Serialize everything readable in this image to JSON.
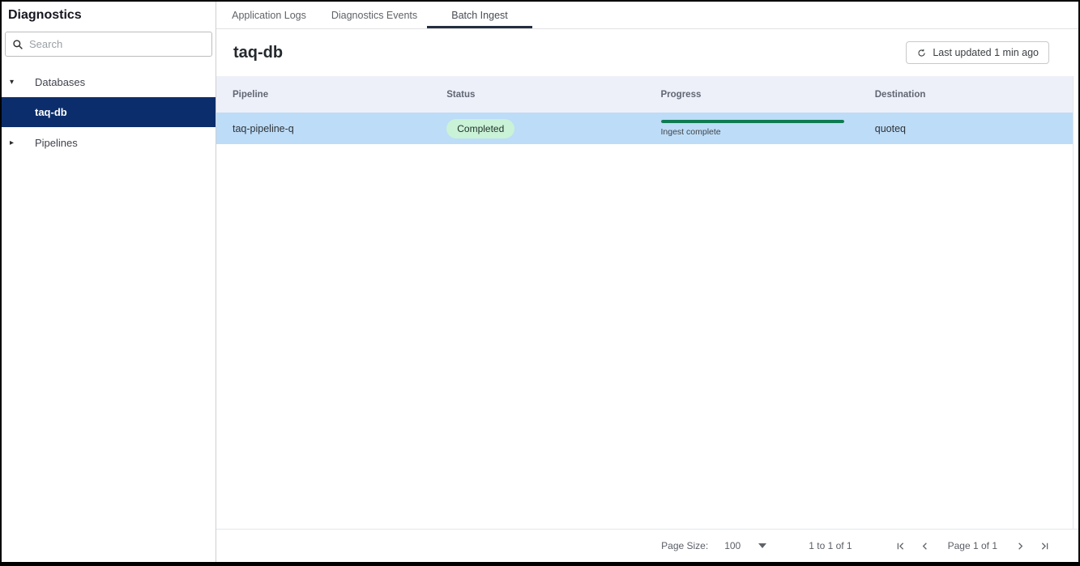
{
  "colors": {
    "accent": "#0c2d6b",
    "row_highlight": "#bddcf7",
    "header_bg": "#eef0f9",
    "badge_bg": "#c9f2d7",
    "progress_green": "#0e7b52",
    "tab_underline": "#232e41"
  },
  "sidebar": {
    "title": "Diagnostics",
    "search": {
      "placeholder": "Search"
    },
    "tree": [
      {
        "label": "Databases",
        "caret": "▾",
        "expanded": true,
        "selected": false,
        "level": 0
      },
      {
        "label": "taq-db",
        "caret": "",
        "expanded": false,
        "selected": true,
        "level": 1
      },
      {
        "label": "Pipelines",
        "caret": "▸",
        "expanded": false,
        "selected": false,
        "level": 0
      }
    ]
  },
  "tabs": [
    {
      "label": "Application Logs",
      "active": false
    },
    {
      "label": "Diagnostics Events",
      "active": false
    },
    {
      "label": "Batch Ingest",
      "active": true
    }
  ],
  "main": {
    "title": "taq-db",
    "last_updated_label": "Last updated 1 min ago"
  },
  "table": {
    "columns": [
      "Pipeline",
      "Status",
      "Progress",
      "Destination"
    ],
    "rows": [
      {
        "pipeline": "taq-pipeline-q",
        "status": "Completed",
        "progress_label": "Ingest complete",
        "progress_percent": 100,
        "destination": "quoteq"
      }
    ]
  },
  "pagination": {
    "page_size_label": "Page Size:",
    "page_size": "100",
    "range_text": "1 to 1 of 1",
    "page_text": "Page 1 of 1"
  },
  "icons": {
    "search": "magnifier",
    "refresh": "circular-arrow",
    "tree_expanded": "▾",
    "tree_collapsed": "▸",
    "page_size_caret": "▾",
    "first_page": "|<",
    "prev_page": "<",
    "next_page": ">",
    "last_page": ">|"
  }
}
